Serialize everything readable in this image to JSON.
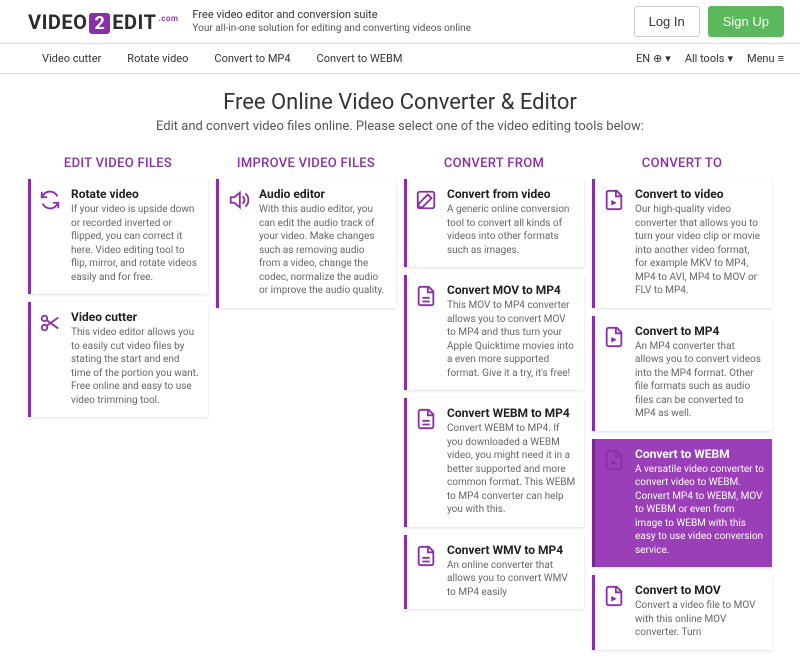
{
  "header": {
    "logo_left": "VIDEO",
    "logo_badge": "2",
    "logo_right": "EDIT",
    "logo_com": ".com",
    "tagline_top": "Free video editor and conversion suite",
    "tagline_sub": "Your all-in-one solution for editing and converting videos online",
    "login": "Log In",
    "signup": "Sign Up"
  },
  "nav": {
    "items": [
      "Video cutter",
      "Rotate video",
      "Convert to MP4",
      "Convert to WEBM"
    ],
    "lang": "EN",
    "alltools": "All tools",
    "menu": "Menu"
  },
  "hero": {
    "title": "Free Online Video Converter & Editor",
    "sub": "Edit and convert video files online. Please select one of the video editing tools below:"
  },
  "cols": {
    "edit": {
      "head": "EDIT VIDEO FILES",
      "cards": [
        {
          "title": "Rotate video",
          "desc": "If your video is upside down or recorded inverted or flipped, you can correct it here. Video editing tool to flip, mirror, and rotate videos easily and for free."
        },
        {
          "title": "Video cutter",
          "desc": "This video editor allows you to easily cut video files by stating the start and end time of the portion you want. Free online and easy to use video trimming tool."
        }
      ]
    },
    "improve": {
      "head": "IMPROVE VIDEO FILES",
      "cards": [
        {
          "title": "Audio editor",
          "desc": "With this audio editor, you can edit the audio track of your video. Make changes such as removing audio from a video, change the codec, normalize the audio or improve the audio quality."
        }
      ]
    },
    "from": {
      "head": "CONVERT FROM",
      "cards": [
        {
          "title": "Convert from video",
          "desc": "A generic online conversion tool to convert all kinds of videos into other formats such as images."
        },
        {
          "title": "Convert MOV to MP4",
          "desc": "This MOV to MP4 converter allows you to convert MOV to MP4 and thus turn your Apple Quicktime movies into a even more supported format. Give it a try, it's free!"
        },
        {
          "title": "Convert WEBM to MP4",
          "desc": "Convert WEBM to MP4. If you downloaded a WEBM video, you might need it in a better supported and more common format. This WEBM to MP4 converter can help you with this."
        },
        {
          "title": "Convert WMV to MP4",
          "desc": "An online converter that allows you to convert WMV to MP4 easily"
        }
      ]
    },
    "to": {
      "head": "CONVERT TO",
      "cards": [
        {
          "title": "Convert to video",
          "desc": "Our high-quality video converter that allows you to turn your video clip or movie into another video format, for example MKV to MP4, MP4 to AVI, MP4 to MOV or FLV to MP4."
        },
        {
          "title": "Convert to MP4",
          "desc": "An MP4 converter that allows you to convert videos into the MP4 format. Other file formats such as audio files can be converted to MP4 as well."
        },
        {
          "title": "Convert to WEBM",
          "desc": "A versatile video converter to convert video to WEBM. Convert MP4 to WEBM, MOV to WEBM or even from image to WEBM with this easy to use video conversion service."
        },
        {
          "title": "Convert to MOV",
          "desc": "Convert a video file to MOV with this online MOV converter. Turn"
        }
      ]
    }
  }
}
